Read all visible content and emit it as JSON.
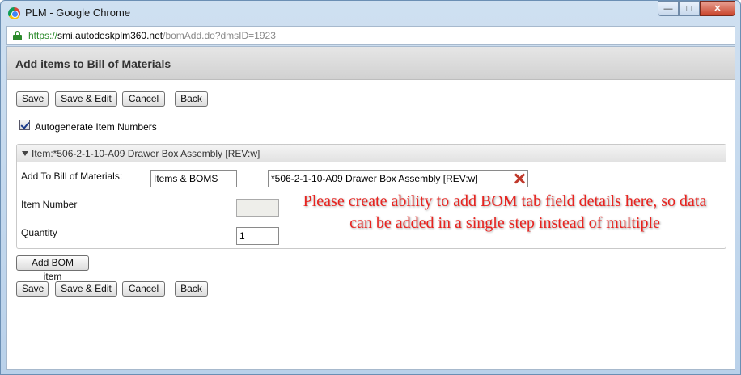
{
  "window": {
    "title": "PLM - Google Chrome",
    "controls": {
      "minimize": "—",
      "maximize": "□",
      "close": "✕"
    },
    "icon": "chrome-icon"
  },
  "address": {
    "scheme": "https://",
    "host": "smi.autodeskplm360.net",
    "path": "/bomAdd.do?dmsID=1923"
  },
  "page": {
    "title": "Add items to Bill of Materials"
  },
  "toolbar_top": {
    "save": "Save",
    "save_edit": "Save & Edit",
    "cancel": "Cancel",
    "back": "Back"
  },
  "autogenerate": {
    "label": "Autogenerate Item Numbers",
    "checked": true
  },
  "item_panel": {
    "title": "Item:*506-2-1-10-A09 Drawer Box Assembly [REV:w]",
    "fields": {
      "add_to_bom_label": "Add To Bill of Materials:",
      "workspace_value": "Items & BOMS",
      "parent_item_value": "*506-2-1-10-A09 Drawer Box Assembly [REV:w]",
      "item_number_label": "Item Number",
      "item_number_value": "",
      "quantity_label": "Quantity",
      "quantity_value": "1"
    }
  },
  "add_bom_item": "Add BOM item",
  "toolbar_bottom": {
    "save": "Save",
    "save_edit": "Save & Edit",
    "cancel": "Cancel",
    "back": "Back"
  },
  "annotation": {
    "text": "Please create ability to add BOM tab field details here, so data can be added in a single step instead of multiple",
    "color": "#e8231f"
  }
}
